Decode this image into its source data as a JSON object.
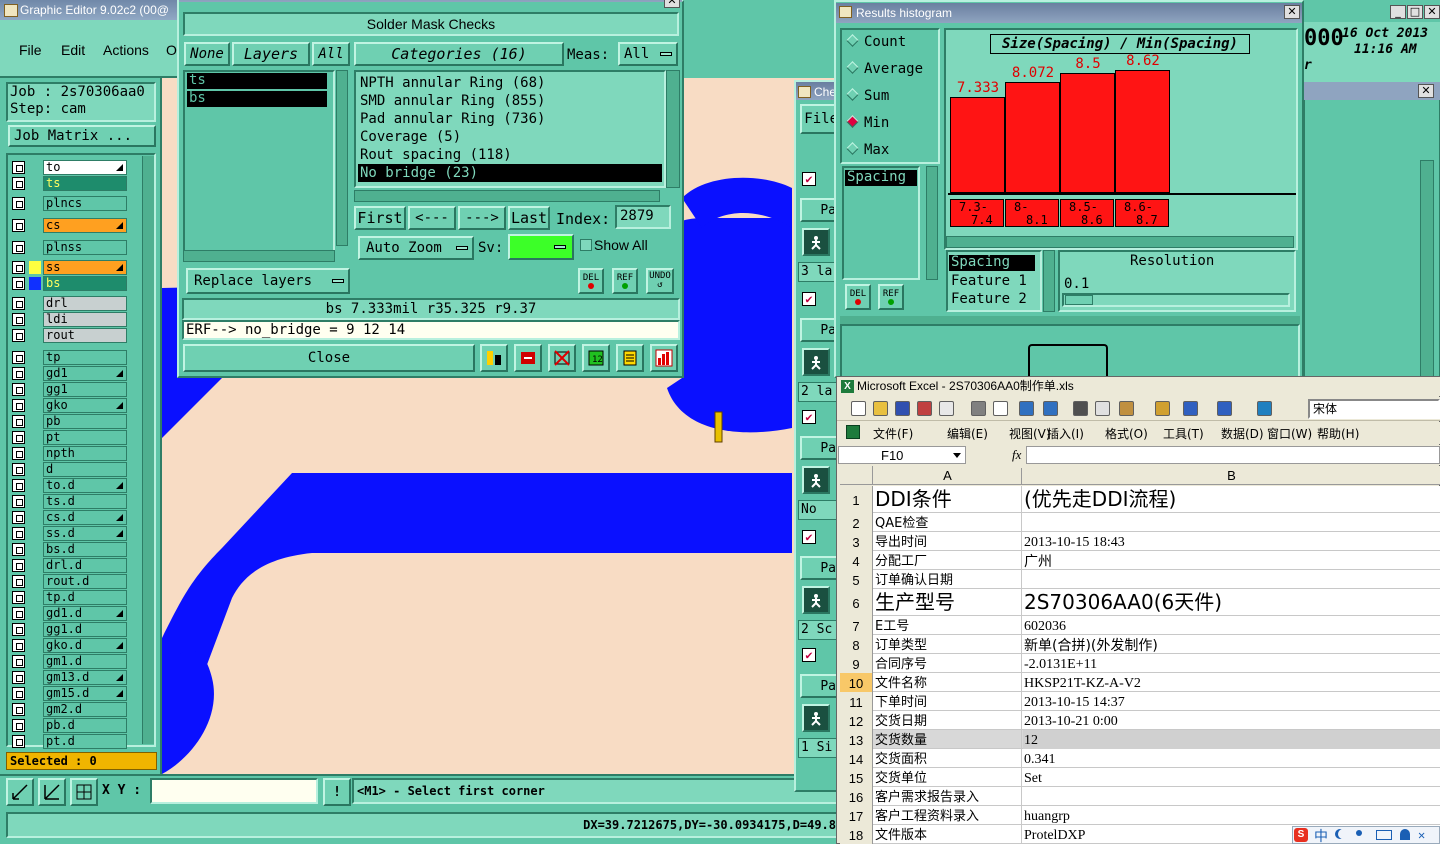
{
  "main": {
    "title": "Graphic Editor 9.02c2 (00@",
    "menu": [
      "File",
      "Edit",
      "Actions",
      "O"
    ],
    "job_label": "Job : 2s70306aa0",
    "step_label": "Step: cam",
    "job_matrix_btn": "Job Matrix ...",
    "layers": [
      {
        "name": "to",
        "color": "#ffffff",
        "icon": "pencil"
      },
      {
        "name": "ts",
        "color": "#1e8c6c",
        "sel": true
      },
      {
        "name": "plncs",
        "color": "#5fc6a8"
      },
      {
        "name": "cs",
        "color": "#ffa020",
        "icon": "pencil"
      },
      {
        "name": "plnss",
        "color": "#5fc6a8"
      },
      {
        "name": "ss",
        "color": "#ffa020",
        "icon": "pencil"
      },
      {
        "name": "bs",
        "color": "#1e8c6c",
        "sel": true
      },
      {
        "name": "drl",
        "color": "#c8d0d0"
      },
      {
        "name": "ldi",
        "color": "#c8d0d0"
      },
      {
        "name": "rout",
        "color": "#c8d0d0"
      },
      {
        "name": "tp",
        "color": "#5fc6a8"
      },
      {
        "name": "gd1",
        "color": "#5fc6a8",
        "icon": "pencil"
      },
      {
        "name": "gg1",
        "color": "#5fc6a8"
      },
      {
        "name": "gko",
        "color": "#5fc6a8",
        "icon": "pencil"
      },
      {
        "name": "pb",
        "color": "#5fc6a8"
      },
      {
        "name": "pt",
        "color": "#5fc6a8"
      },
      {
        "name": "npth",
        "color": "#5fc6a8"
      },
      {
        "name": "d",
        "color": "#5fc6a8"
      },
      {
        "name": "to.d",
        "color": "#5fc6a8",
        "icon": "pencil"
      },
      {
        "name": "ts.d",
        "color": "#5fc6a8"
      },
      {
        "name": "cs.d",
        "color": "#5fc6a8",
        "icon": "pencil"
      },
      {
        "name": "ss.d",
        "color": "#5fc6a8",
        "icon": "pencil"
      },
      {
        "name": "bs.d",
        "color": "#5fc6a8"
      },
      {
        "name": "drl.d",
        "color": "#5fc6a8"
      },
      {
        "name": "rout.d",
        "color": "#5fc6a8"
      },
      {
        "name": "tp.d",
        "color": "#5fc6a8"
      },
      {
        "name": "gd1.d",
        "color": "#5fc6a8",
        "icon": "pencil"
      },
      {
        "name": "gg1.d",
        "color": "#5fc6a8"
      },
      {
        "name": "gko.d",
        "color": "#5fc6a8",
        "icon": "pencil"
      },
      {
        "name": "gm1.d",
        "color": "#5fc6a8"
      },
      {
        "name": "gm13.d",
        "color": "#5fc6a8",
        "icon": "pencil"
      },
      {
        "name": "gm15.d",
        "color": "#5fc6a8",
        "icon": "pencil"
      },
      {
        "name": "gm2.d",
        "color": "#5fc6a8"
      },
      {
        "name": "pb.d",
        "color": "#5fc6a8"
      },
      {
        "name": "pt.d",
        "color": "#5fc6a8"
      }
    ],
    "selected": "Selected : 0",
    "xy_label": "X Y :",
    "xy_value": "",
    "status_msg": "<M1> - Select first corner",
    "coords": "DX=39.7212675,DY=-30.0934175,D=49.8",
    "clock_num": "000",
    "clock_date": "16 Oct 2013",
    "clock_time": "11:16 AM",
    "clock_extra": "r"
  },
  "results_viewer": {
    "title": "Results Viewer",
    "heading": "Solder Mask Checks",
    "btn_none": "None",
    "btn_layers": "Layers",
    "btn_all": "All",
    "layer_list": [
      "ts",
      "bs"
    ],
    "categories_label": "Categories (16)",
    "meas_label": "Meas:",
    "meas_value": "All",
    "categories": [
      {
        "text": "NPTH annular Ring (68)"
      },
      {
        "text": "SMD annular Ring (855)"
      },
      {
        "text": "Pad annular Ring (736)"
      },
      {
        "text": "Coverage (5)"
      },
      {
        "text": "Rout spacing (118)"
      },
      {
        "text": "No bridge (23)",
        "selected": true
      }
    ],
    "btn_first": "First",
    "btn_prev": "<---",
    "btn_next": "--->",
    "btn_last": "Last",
    "index_label": "Index:",
    "index_value": "2879",
    "auto_zoom": "Auto Zoom",
    "sv_label": "Sv:",
    "show_all": "Show All",
    "replace_layers": "Replace layers",
    "del": "DEL",
    "ref": "REF",
    "undo": "UNDO",
    "info_line": "bs 7.333mil  r35.325  r9.37",
    "erf_line": "ERF--> no_bridge = 9 12 14",
    "close": "Close"
  },
  "histogram": {
    "title": "Results histogram",
    "stats": [
      "Count",
      "Average",
      "Sum",
      "Min",
      "Max"
    ],
    "selected_stat": "Min",
    "list_item": "Spacing",
    "chart_title": "Size(Spacing) / Min(Spacing)",
    "del": "DEL",
    "ref": "REF",
    "feature_list": [
      "Spacing",
      "Feature 1",
      "Feature 2"
    ],
    "resolution_label": "Resolution",
    "resolution_value": "0.1"
  },
  "chart_data": {
    "type": "bar",
    "title": "Size(Spacing) / Min(Spacing)",
    "categories": [
      "7.3-7.4",
      "8-8.1",
      "8.5-8.6",
      "8.6-8.7"
    ],
    "category_lines": [
      [
        "7.3-",
        "7.4"
      ],
      [
        "8-",
        "8.1"
      ],
      [
        "8.5-",
        "8.6"
      ],
      [
        "8.6-",
        "8.7"
      ]
    ],
    "values": [
      7.333,
      8.072,
      8.5,
      8.62
    ],
    "value_labels": [
      "7.333",
      "8.072",
      "8.5",
      "8.62"
    ],
    "ylim": [
      0,
      8.62
    ],
    "bar_color": "#ff1414",
    "grid": false
  },
  "side_window": {
    "title": "Chec",
    "file_menu": "File",
    "rows": [
      "3 la",
      "2 la",
      "No",
      "2 Sc",
      "1 Si"
    ],
    "labels_pa": "Pa"
  },
  "excel": {
    "title": "Microsoft Excel - 2S70306AA0制作单.xls",
    "menus": [
      "文件(F)",
      "编辑(E)",
      "视图(V)",
      "插入(I)",
      "格式(O)",
      "工具(T)",
      "数据(D)",
      "窗口(W)",
      "帮助(H)"
    ],
    "font_name": "宋体",
    "cell_ref": "F10",
    "fx": "fx",
    "col_a": "A",
    "col_b": "B",
    "rows": [
      {
        "n": "1",
        "a": "DDI条件",
        "b": "(优先走DDI流程)",
        "big": true
      },
      {
        "n": "2",
        "a": "QAE检查",
        "b": ""
      },
      {
        "n": "3",
        "a": "导出时间",
        "b": "2013-10-15 18:43"
      },
      {
        "n": "4",
        "a": "分配工厂",
        "b": "广州"
      },
      {
        "n": "5",
        "a": "订单确认日期",
        "b": ""
      },
      {
        "n": "6",
        "a": "生产型号",
        "b": "2S70306AA0(6天件)",
        "big": true
      },
      {
        "n": "7",
        "a": "E工号",
        "b": "602036"
      },
      {
        "n": "8",
        "a": "订单类型",
        "b": "新单(合拼)(外发制作)"
      },
      {
        "n": "9",
        "a": "合同序号",
        "b": "-2.0131E+11"
      },
      {
        "n": "10",
        "a": "文件名称",
        "b": "HKSP21T-KZ-A-V2",
        "active": true
      },
      {
        "n": "11",
        "a": "下单时间",
        "b": "2013-10-15 14:37"
      },
      {
        "n": "12",
        "a": "交货日期",
        "b": "2013-10-21  0:00"
      },
      {
        "n": "13",
        "a": "交货数量",
        "b": "12",
        "hl": true
      },
      {
        "n": "14",
        "a": "交货面积",
        "b": "0.341"
      },
      {
        "n": "15",
        "a": "交货单位",
        "b": "Set"
      },
      {
        "n": "16",
        "a": "客户需求报告录入",
        "b": ""
      },
      {
        "n": "17",
        "a": "客户工程资料录入",
        "b": "huangrp"
      },
      {
        "n": "18",
        "a": "文件版本",
        "b": "ProtelDXP"
      }
    ],
    "ime": "中"
  }
}
